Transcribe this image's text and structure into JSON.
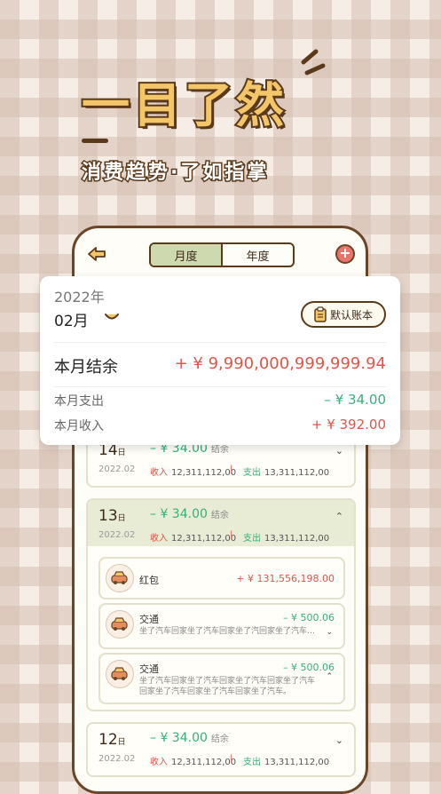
{
  "headline": {
    "title": "一目了然",
    "subtitle": "消费趋势·了如指掌"
  },
  "colors": {
    "expense": "#35b07a",
    "income": "#e2544a",
    "frame": "#6a4527"
  },
  "app": {
    "tabs": [
      {
        "label": "月度",
        "active": true
      },
      {
        "label": "年度",
        "active": false
      }
    ],
    "summary": {
      "year": "2022年",
      "month": "02月",
      "book_label": "默认账本",
      "net_label": "本月结余",
      "net_value": "+ ¥ 9,990,000,999,999.94",
      "expense_label": "本月支出",
      "expense_value": "– ¥ 34.00",
      "income_label": "本月收入",
      "income_value": "+ ¥ 392.00"
    },
    "days": [
      {
        "day": "14",
        "unit": "日",
        "amount": "– ¥ 34.00",
        "tag": "结余",
        "date": "2022.02",
        "income_label": "收入",
        "income": "12,311,112,00",
        "sep": "|",
        "expense_label": "支出",
        "expense": "13,311,112,00"
      },
      {
        "day": "13",
        "unit": "日",
        "amount": "– ¥ 34.00",
        "tag": "结余",
        "date": "2022.02",
        "income_label": "收入",
        "income": "12,311,112,00",
        "sep": "|",
        "expense_label": "支出",
        "expense": "13,311,112,00"
      },
      {
        "day": "12",
        "unit": "日",
        "amount": "– ¥ 34.00",
        "tag": "结余",
        "date": "2022.02",
        "income_label": "收入",
        "income": "12,311,112,00",
        "sep": "|",
        "expense_label": "支出",
        "expense": "13,311,112,00"
      }
    ],
    "items": [
      {
        "name": "红包",
        "value": "+ ¥ 131,556,198.00",
        "note": ""
      },
      {
        "name": "交通",
        "value": "– ¥ 500.06",
        "note": "坐了汽车回家坐了汽车回家坐了汽回家坐了汽车…"
      },
      {
        "name": "交通",
        "value": "– ¥ 500.06",
        "note": "坐了汽车回家坐了汽车回家坐了汽车回家坐了汽车回家坐了汽车回家坐了汽车回家坐了汽车。"
      }
    ]
  }
}
